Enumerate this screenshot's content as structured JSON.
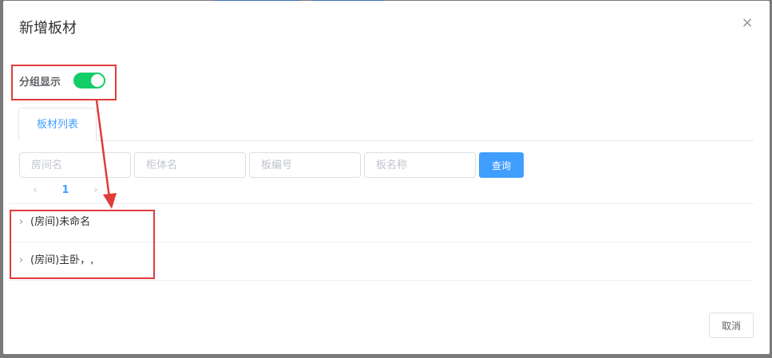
{
  "dialog": {
    "title": "新增板材",
    "close_symbol": "×"
  },
  "group_display": {
    "label": "分组显示",
    "enabled": true,
    "on_color": "#13ce66"
  },
  "tabs": [
    {
      "label": "板材列表",
      "active": true
    }
  ],
  "search": {
    "room_placeholder": "房间名",
    "cabinet_placeholder": "柜体名",
    "board_code_placeholder": "板编号",
    "board_name_placeholder": "板名称",
    "query_label": "查询"
  },
  "pagination": {
    "prev_symbol": "‹",
    "current_page": "1",
    "next_symbol": "›"
  },
  "groups": [
    {
      "chevron": "›",
      "label": "(房间)未命名"
    },
    {
      "chevron": "›",
      "label": "(房间)主卧，,"
    }
  ],
  "footer": {
    "cancel_label": "取消"
  },
  "colors": {
    "accent": "#409eff",
    "annotation": "#e03c3c"
  }
}
